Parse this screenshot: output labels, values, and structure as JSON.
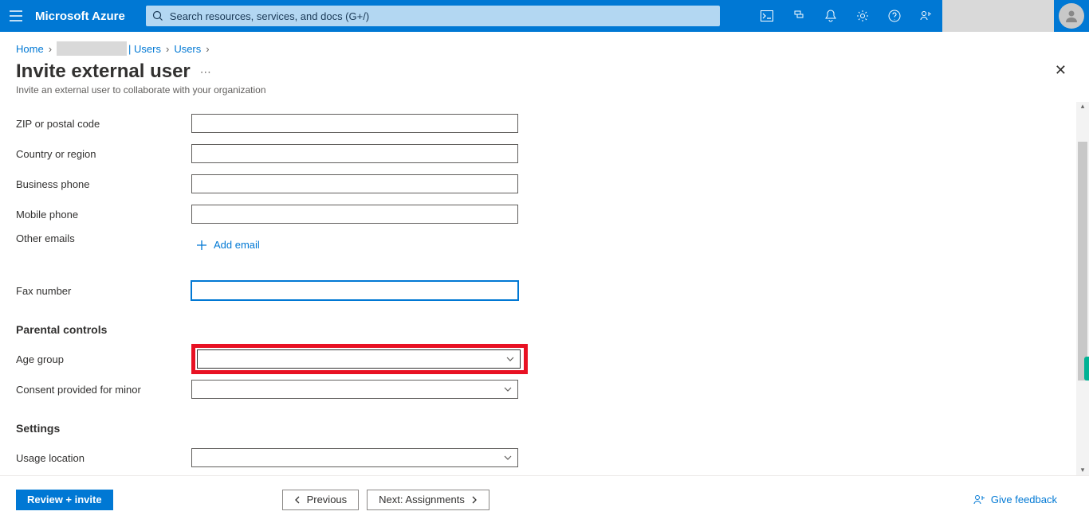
{
  "brand": "Microsoft Azure",
  "search": {
    "placeholder": "Search resources, services, and docs (G+/)"
  },
  "breadcrumb": {
    "home": "Home",
    "users1": "| Users",
    "users2": "Users"
  },
  "page": {
    "title": "Invite external user",
    "subtitle": "Invite an external user to collaborate with your organization"
  },
  "form": {
    "zip_label": "ZIP or postal code",
    "country_label": "Country or region",
    "business_phone_label": "Business phone",
    "mobile_phone_label": "Mobile phone",
    "other_emails_label": "Other emails",
    "add_email_label": "Add email",
    "fax_label": "Fax number",
    "parental_section": "Parental controls",
    "age_group_label": "Age group",
    "consent_label": "Consent provided for minor",
    "settings_section": "Settings",
    "usage_location_label": "Usage location"
  },
  "footer": {
    "review": "Review + invite",
    "previous": "Previous",
    "next": "Next: Assignments",
    "feedback": "Give feedback"
  },
  "colors": {
    "primary": "#0078d4",
    "highlight": "#e81123",
    "sidetab": "#00b294"
  }
}
